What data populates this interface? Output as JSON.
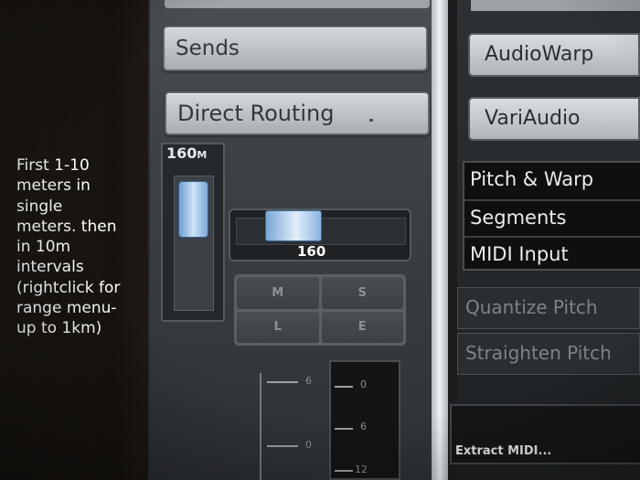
{
  "annotation": {
    "text": "First 1-10\nmeters in\nsingle\nmeters. then\nin 10m\nintervals\n(rightclick for\nrange menu-\nup to 1km)"
  },
  "left_panel": {
    "sends_label": "Sends",
    "direct_routing_label": "Direct Routing",
    "vertical_fader": {
      "value": "160",
      "unit": "M"
    },
    "horizontal_fader": {
      "value": "160"
    },
    "buttons": {
      "mute": "M",
      "solo": "S",
      "listen": "L",
      "edit": "E"
    },
    "meter_scale": {
      "left": [
        "6",
        "0"
      ],
      "right": [
        "0",
        "6",
        "12"
      ]
    }
  },
  "right_panel": {
    "audiowarp_label": "AudioWarp",
    "variaudio_label": "VariAudio",
    "list_items": [
      "Pitch & Warp",
      "Segments",
      "MIDI Input"
    ],
    "quantize_pitch_label": "Quantize Pitch",
    "straighten_pitch_label": "Straighten Pitch",
    "extract_midi_label": "Extract MIDI..."
  },
  "colors": {
    "fader_blue": "#8ab4e0",
    "button_light": "#c8ccd0",
    "panel_dark": "#2e3236"
  }
}
